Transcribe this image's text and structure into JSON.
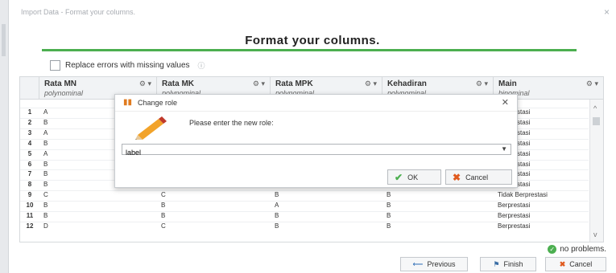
{
  "window": {
    "title": "Import Data - Format your columns.",
    "close": "×"
  },
  "header": {
    "title": "Format your columns."
  },
  "options": {
    "replace_errors_label": "Replace errors with missing values",
    "info_icon": "info-icon"
  },
  "table": {
    "columns": [
      {
        "name": "Rata MN",
        "role": "polynominal"
      },
      {
        "name": "Rata MK",
        "role": "polynominal"
      },
      {
        "name": "Rata MPK",
        "role": "polynominal"
      },
      {
        "name": "Kehadiran",
        "role": "polynominal"
      },
      {
        "name": "Main",
        "role": "binominal"
      }
    ],
    "rows": [
      {
        "num": "1",
        "cells": [
          "A",
          "",
          "",
          "",
          "Berprestasi"
        ]
      },
      {
        "num": "2",
        "cells": [
          "B",
          "",
          "",
          "",
          "Berprestasi"
        ]
      },
      {
        "num": "3",
        "cells": [
          "A",
          "",
          "",
          "",
          "Berprestasi"
        ]
      },
      {
        "num": "4",
        "cells": [
          "B",
          "",
          "",
          "",
          "Berprestasi"
        ]
      },
      {
        "num": "5",
        "cells": [
          "A",
          "",
          "",
          "",
          "Berprestasi"
        ]
      },
      {
        "num": "6",
        "cells": [
          "B",
          "",
          "",
          "",
          "Berprestasi"
        ]
      },
      {
        "num": "7",
        "cells": [
          "B",
          "",
          "",
          "",
          "Berprestasi"
        ]
      },
      {
        "num": "8",
        "cells": [
          "B",
          "B",
          "B",
          "B",
          "Berprestasi"
        ]
      },
      {
        "num": "9",
        "cells": [
          "C",
          "C",
          "B",
          "B",
          "Tidak Berprestasi"
        ]
      },
      {
        "num": "10",
        "cells": [
          "B",
          "B",
          "A",
          "B",
          "Berprestasi"
        ]
      },
      {
        "num": "11",
        "cells": [
          "B",
          "B",
          "B",
          "B",
          "Berprestasi"
        ]
      },
      {
        "num": "12",
        "cells": [
          "D",
          "C",
          "B",
          "B",
          "Berprestasi"
        ]
      }
    ]
  },
  "status": {
    "text": "no problems."
  },
  "buttons": {
    "previous": "Previous",
    "finish": "Finish",
    "cancel": "Cancel"
  },
  "dialog": {
    "title": "Change role",
    "prompt": "Please enter the new role:",
    "value": "label",
    "ok": "OK",
    "cancel": "Cancel"
  }
}
